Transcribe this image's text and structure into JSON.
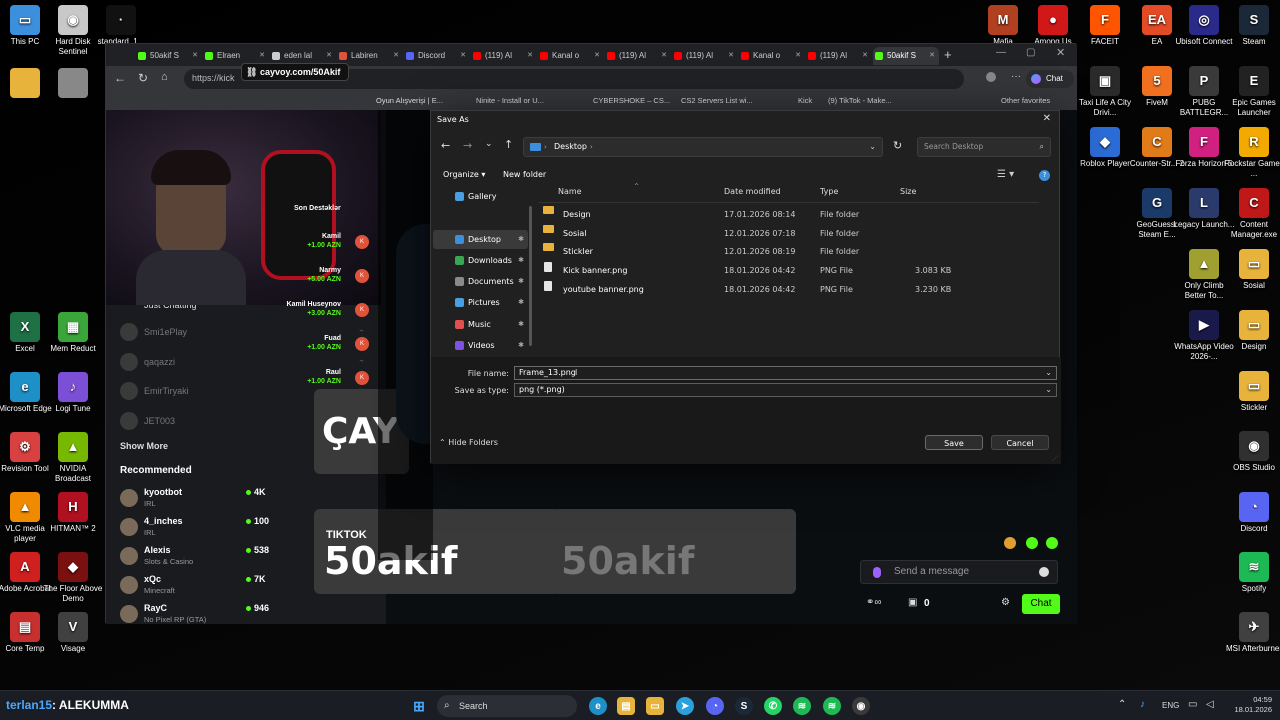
{
  "desktop": {
    "left_icons": [
      {
        "label": "This PC",
        "color": "#3c8fdc",
        "glyph": "▭"
      },
      {
        "label": "Hard Disk Sentinel",
        "color": "#c8c8c8",
        "glyph": "◉"
      },
      {
        "label": "standard_1...",
        "color": "#111111",
        "glyph": "·"
      },
      {
        "label": "Excel",
        "color": "#1e7145",
        "glyph": "X"
      },
      {
        "label": "Mem Reduct",
        "color": "#3aa63a",
        "glyph": "▦"
      },
      {
        "label": "Microsoft Edge",
        "color": "#1e90c8",
        "glyph": "e"
      },
      {
        "label": "Logi Tune",
        "color": "#7b4fd6",
        "glyph": "♪"
      },
      {
        "label": "Revision Tool",
        "color": "#d94040",
        "glyph": "⚙"
      },
      {
        "label": "NVIDIA Broadcast",
        "color": "#76b900",
        "glyph": "▲"
      },
      {
        "label": "VLC media player",
        "color": "#f08a00",
        "glyph": "▲"
      },
      {
        "label": "HITMAN™ 2",
        "color": "#b01020",
        "glyph": "H"
      },
      {
        "label": "Adobe Acrobat",
        "color": "#d01f1f",
        "glyph": "A"
      },
      {
        "label": "The Floor Above Demo",
        "color": "#7a1010",
        "glyph": "◆"
      },
      {
        "label": "Core Temp",
        "color": "#c83030",
        "glyph": "▤"
      },
      {
        "label": "Visage",
        "color": "#404040",
        "glyph": "V"
      }
    ],
    "right_icons": [
      {
        "label": "Mafia",
        "color": "#b04020",
        "glyph": "M"
      },
      {
        "label": "Among Us",
        "color": "#d01818",
        "glyph": "●"
      },
      {
        "label": "FACEIT",
        "color": "#ff5500",
        "glyph": "F"
      },
      {
        "label": "EA",
        "color": "#e34b27",
        "glyph": "EA"
      },
      {
        "label": "Ubisoft Connect",
        "color": "#2a2a8a",
        "glyph": "◎"
      },
      {
        "label": "Steam",
        "color": "#1b2838",
        "glyph": "S"
      },
      {
        "label": "Taxi Life A City Drivi...",
        "color": "#2a2a2a",
        "glyph": "▣"
      },
      {
        "label": "FiveM",
        "color": "#f07020",
        "glyph": "5"
      },
      {
        "label": "PUBG BATTLEGR...",
        "color": "#3a3a3a",
        "glyph": "P"
      },
      {
        "label": "Epic Games Launcher",
        "color": "#222222",
        "glyph": "E"
      },
      {
        "label": "Roblox Player",
        "color": "#2b6cd6",
        "glyph": "◆"
      },
      {
        "label": "Counter-Str... 2",
        "color": "#e07b1a",
        "glyph": "C"
      },
      {
        "label": "Forza Horizon 5",
        "color": "#d02080",
        "glyph": "F"
      },
      {
        "label": "Rockstar Games ...",
        "color": "#f2a900",
        "glyph": "R"
      },
      {
        "label": "GeoGuessr Steam E...",
        "color": "#1a3a6a",
        "glyph": "G"
      },
      {
        "label": "Legacy Launch...",
        "color": "#2a3a6a",
        "glyph": "L"
      },
      {
        "label": "Content Manager.exe",
        "color": "#c01818",
        "glyph": "C"
      },
      {
        "label": "Only Climb Better To...",
        "color": "#a0a030",
        "glyph": "▲"
      },
      {
        "label": "Sosial",
        "color": "#e8b33a",
        "glyph": "▭"
      },
      {
        "label": "WhatsApp Video 2026-...",
        "color": "#1a1a4a",
        "glyph": "▶"
      },
      {
        "label": "Design",
        "color": "#e8b33a",
        "glyph": "▭"
      },
      {
        "label": "Stickler",
        "color": "#e8b33a",
        "glyph": "▭"
      },
      {
        "label": "OBS Studio",
        "color": "#303030",
        "glyph": "◉"
      },
      {
        "label": "Discord",
        "color": "#5865f2",
        "glyph": "◔"
      },
      {
        "label": "Spotify",
        "color": "#1db954",
        "glyph": "≋"
      },
      {
        "label": "MSI Afterburner",
        "color": "#404040",
        "glyph": "✈"
      }
    ]
  },
  "browser": {
    "tabs": [
      "50akif S",
      "Elraen",
      "eden lal",
      "Labiren",
      "Discord",
      "(119) Al",
      "Kanal o",
      "(119) Al",
      "(119) Al",
      "Kanal o",
      "(119) Al",
      "50akif S"
    ],
    "tab_colors": [
      "#53fc18",
      "#53fc18",
      "#cccccc",
      "#e0533b",
      "#5865f2",
      "#ff0000",
      "#ff0000",
      "#ff0000",
      "#ff0000",
      "#ff0000",
      "#ff0000",
      "#53fc18"
    ],
    "url_partial": "https://kick",
    "url_tooltip": "cayvoy.com/50Akif",
    "bookmarks": [
      "Oyun Alışverişi | E...",
      "Ninite - Install or U...",
      "CYBERSHOKE – CS...",
      "CS2 Servers List wi...",
      "Kick",
      "(9) TikTok - Make..."
    ],
    "other_favorites": "Other favorites",
    "chat_btn": "Chat"
  },
  "stream": {
    "donors_title": "Son Destəklər",
    "donors": [
      {
        "name": "Kamil",
        "amount": "+1.00 AZN"
      },
      {
        "name": "Narmy",
        "amount": "+5.00 AZN"
      },
      {
        "name": "Kamil Huseynov",
        "amount": "+3.00 AZN"
      },
      {
        "name": "Fuad",
        "amount": "+1.00 AZN"
      },
      {
        "name": "Raul",
        "amount": "+1.00 AZN"
      }
    ],
    "banner_text_1": "ÇAY",
    "banner_tiktok": "TIKTOK",
    "banner_text_2": "50akif",
    "banner_text_3": "50akif"
  },
  "sidebar": {
    "just_chatting": "Just Chatting",
    "following": [
      "Smi1ePlay",
      "qaqazzi",
      "EmirTiryaki",
      "JET003"
    ],
    "show_more": "Show More",
    "recommended_title": "Recommended",
    "recommended": [
      {
        "name": "kyootbot",
        "category": "IRL",
        "viewers": "4K"
      },
      {
        "name": "4_inches",
        "category": "IRL",
        "viewers": "100"
      },
      {
        "name": "Alexis",
        "category": "Slots & Casino",
        "viewers": "538"
      },
      {
        "name": "xQc",
        "category": "Minecraft",
        "viewers": "7K"
      },
      {
        "name": "RayC",
        "category": "No Pixel RP (GTA)",
        "viewers": "946"
      }
    ]
  },
  "chat": {
    "placeholder": "Send a message",
    "points": "0",
    "send_label": "Chat"
  },
  "dialog": {
    "title": "Save As",
    "path_label": "Desktop",
    "search_placeholder": "Search Desktop",
    "organize": "Organize",
    "new_folder": "New folder",
    "nav_items": [
      {
        "label": "Gallery",
        "color": "#4a9fe0"
      },
      {
        "label": "Desktop",
        "color": "#3c8fdc"
      },
      {
        "label": "Downloads",
        "color": "#3aa655"
      },
      {
        "label": "Documents",
        "color": "#8a8a8a"
      },
      {
        "label": "Pictures",
        "color": "#4a9fe0"
      },
      {
        "label": "Music",
        "color": "#e05050"
      },
      {
        "label": "Videos",
        "color": "#8050e0"
      }
    ],
    "columns": {
      "name": "Name",
      "date": "Date modified",
      "type": "Type",
      "size": "Size"
    },
    "files": [
      {
        "name": "Design",
        "date": "17.01.2026 08:14",
        "type": "File folder",
        "size": "",
        "kind": "folder"
      },
      {
        "name": "Sosial",
        "date": "12.01.2026 07:18",
        "type": "File folder",
        "size": "",
        "kind": "folder"
      },
      {
        "name": "Stickler",
        "date": "12.01.2026 08:19",
        "type": "File folder",
        "size": "",
        "kind": "folder"
      },
      {
        "name": "Kick banner.png",
        "date": "18.01.2026 04:42",
        "type": "PNG File",
        "size": "3.083 KB",
        "kind": "png"
      },
      {
        "name": "youtube banner.png",
        "date": "18.01.2026 04:42",
        "type": "PNG File",
        "size": "3.230 KB",
        "kind": "png"
      }
    ],
    "file_name_label": "File name:",
    "file_name_value": "Frame_13.png",
    "save_type_label": "Save as type:",
    "save_type_value": "png (*.png)",
    "hide_folders": "Hide Folders",
    "save": "Save",
    "cancel": "Cancel"
  },
  "taskbar": {
    "overlay_user": "terlan15",
    "overlay_text": ": ALEKUMMA",
    "search": "Search",
    "lang": "ENG",
    "time": "04:59",
    "date": "18.01.2026"
  }
}
